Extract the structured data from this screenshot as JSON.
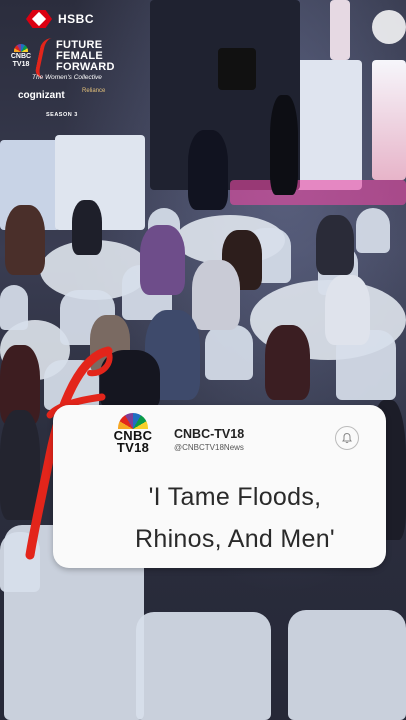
{
  "overlay": {
    "hsbc_label": "HSBC",
    "event_logo": {
      "channel_small": "CNBC TV18",
      "line1": "FUTURE",
      "line2": "FEMALE",
      "line3": "FORWARD",
      "tagline": "The Women's Collective",
      "sponsor1": "cognizant",
      "sponsor2": "Reliance",
      "season": "SEASON 3"
    }
  },
  "card": {
    "logo_text_line1": "CNBC",
    "logo_text_line2": "TV18",
    "channel_name": "CNBC-TV18",
    "channel_handle": "@CNBCTV18News",
    "headline_line1": "'I Tame Floods,",
    "headline_line2": "Rhinos, And Men'"
  },
  "colors": {
    "accent_red": "#e3251b",
    "hsbc_red": "#db0011",
    "card_bg": "#fafafa"
  },
  "icons": {
    "notification": "bell-icon"
  }
}
